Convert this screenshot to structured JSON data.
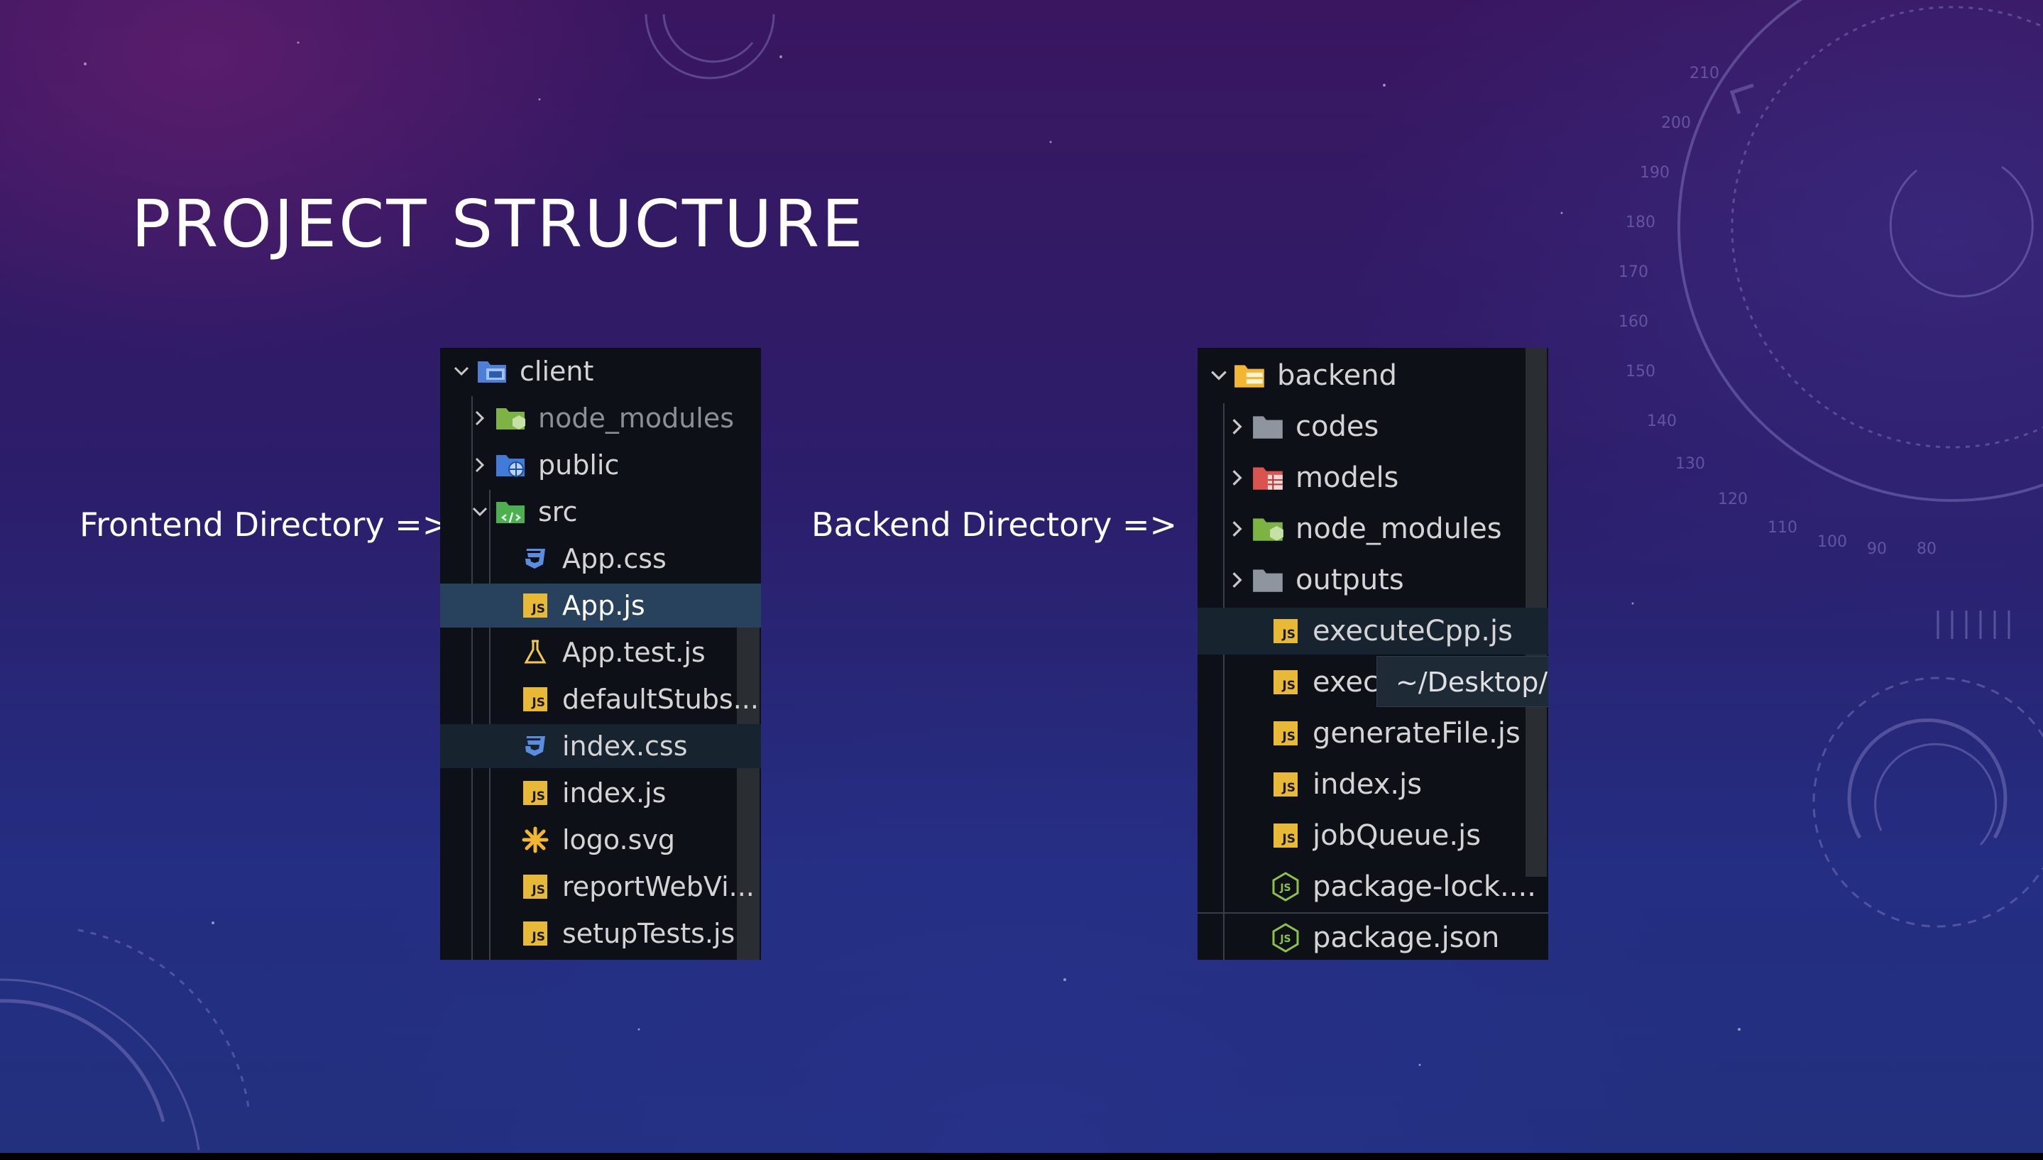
{
  "slide": {
    "title": "PROJECT STRUCTURE",
    "frontend_label": "Frontend Directory =>",
    "backend_label": "Backend Directory =>"
  },
  "frontend": {
    "items": [
      {
        "label": "client",
        "icon": "client-folder-icon",
        "chevron": "down"
      },
      {
        "label": "node_modules",
        "icon": "node-folder-icon",
        "chevron": "right"
      },
      {
        "label": "public",
        "icon": "globe-folder-icon",
        "chevron": "right"
      },
      {
        "label": "src",
        "icon": "src-folder-icon",
        "chevron": "down"
      },
      {
        "label": "App.css",
        "icon": "css-file-icon"
      },
      {
        "label": "App.js",
        "icon": "js-file-icon",
        "state": "selected"
      },
      {
        "label": "App.test.js",
        "icon": "test-flask-icon"
      },
      {
        "label": "defaultStubs...",
        "icon": "js-file-icon"
      },
      {
        "label": "index.css",
        "icon": "css-file-icon",
        "state": "hover"
      },
      {
        "label": "index.js",
        "icon": "js-file-icon"
      },
      {
        "label": "logo.svg",
        "icon": "svg-asterisk-icon"
      },
      {
        "label": "reportWebVi...",
        "icon": "js-file-icon"
      },
      {
        "label": "setupTests.js",
        "icon": "js-file-icon"
      }
    ]
  },
  "backend": {
    "items": [
      {
        "label": "backend",
        "icon": "server-folder-icon",
        "chevron": "down"
      },
      {
        "label": "codes",
        "icon": "folder-icon",
        "chevron": "right"
      },
      {
        "label": "models",
        "icon": "models-folder-icon",
        "chevron": "right"
      },
      {
        "label": "node_modules",
        "icon": "node-folder-icon",
        "chevron": "right"
      },
      {
        "label": "outputs",
        "icon": "folder-icon",
        "chevron": "right"
      },
      {
        "label": "executeCpp.js",
        "icon": "js-file-icon",
        "state": "hover"
      },
      {
        "label": "exec",
        "icon": "js-file-icon"
      },
      {
        "label": "generateFile.js",
        "icon": "js-file-icon"
      },
      {
        "label": "index.js",
        "icon": "js-file-icon"
      },
      {
        "label": "jobQueue.js",
        "icon": "js-file-icon"
      },
      {
        "label": "package-lock....",
        "icon": "node-hex-icon"
      },
      {
        "label": "package.json",
        "icon": "node-hex-icon"
      }
    ],
    "tooltip": "~/Desktop/F"
  },
  "colors": {
    "panel_bg": "#0d1117",
    "selected_row": "#28415c",
    "js_badge": "#e8b936",
    "css_icon": "#5a8de0",
    "node_green": "#8bc34a"
  },
  "decor_ticks": [
    "210",
    "200",
    "190",
    "180",
    "170",
    "160",
    "150",
    "140",
    "130",
    "120",
    "110",
    "100",
    "90",
    "80"
  ]
}
